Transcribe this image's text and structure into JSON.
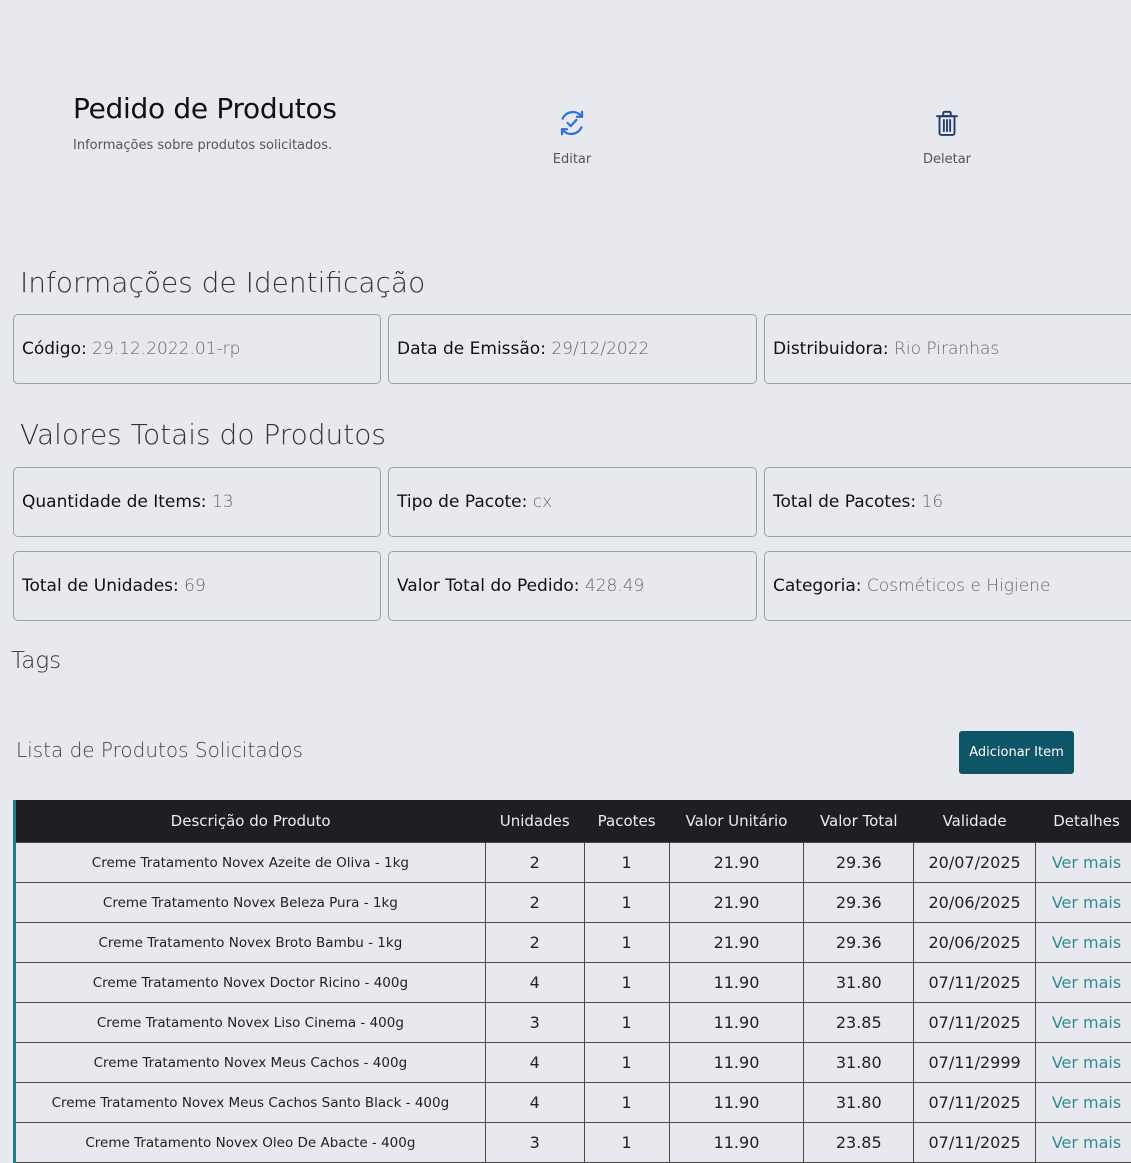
{
  "header": {
    "title": "Pedido de Produtos",
    "subtitle": "Informações sobre produtos solicitados.",
    "edit_label": "Editar",
    "delete_label": "Deletar"
  },
  "identification": {
    "title": "Informações de Identificação",
    "code_label": "Código:",
    "code_value": "29.12.2022.01-rp",
    "date_label": "Data de Emissão:",
    "date_value": "29/12/2022",
    "distributor_label": "Distribuidora:",
    "distributor_value": "Rio Piranhas"
  },
  "totals": {
    "title": "Valores Totais do Produtos",
    "items_label": "Quantidade de Items:",
    "items_value": "13",
    "package_type_label": "Tipo de Pacote:",
    "package_type_value": "cx",
    "total_packages_label": "Total de Pacotes:",
    "total_packages_value": "16",
    "total_units_label": "Total de Unidades:",
    "total_units_value": "69",
    "order_total_label": "Valor Total do Pedido:",
    "order_total_value": "428.49",
    "category_label": "Categoria:",
    "category_value": "Cosméticos e Higiene"
  },
  "tags": {
    "title": "Tags"
  },
  "product_list": {
    "title": "Lista de Produtos Solicitados",
    "add_button_label": "Adicionar Item",
    "columns": [
      "Descrição do Produto",
      "Unidades",
      "Pacotes",
      "Valor Unitário",
      "Valor Total",
      "Validade",
      "Detalhes"
    ],
    "rows": [
      {
        "description": "Creme Tratamento Novex Azeite de Oliva - 1kg",
        "units": "2",
        "packages": "1",
        "unit_price": "21.90",
        "total": "29.36",
        "expiry": "20/07/2025",
        "details": "Ver mais"
      },
      {
        "description": "Creme Tratamento Novex Beleza Pura - 1kg",
        "units": "2",
        "packages": "1",
        "unit_price": "21.90",
        "total": "29.36",
        "expiry": "20/06/2025",
        "details": "Ver mais"
      },
      {
        "description": "Creme Tratamento Novex Broto Bambu - 1kg",
        "units": "2",
        "packages": "1",
        "unit_price": "21.90",
        "total": "29.36",
        "expiry": "20/06/2025",
        "details": "Ver mais"
      },
      {
        "description": "Creme Tratamento Novex Doctor Ricino - 400g",
        "units": "4",
        "packages": "1",
        "unit_price": "11.90",
        "total": "31.80",
        "expiry": "07/11/2025",
        "details": "Ver mais"
      },
      {
        "description": "Creme Tratamento Novex Liso Cinema - 400g",
        "units": "3",
        "packages": "1",
        "unit_price": "11.90",
        "total": "23.85",
        "expiry": "07/11/2025",
        "details": "Ver mais"
      },
      {
        "description": "Creme Tratamento Novex Meus Cachos - 400g",
        "units": "4",
        "packages": "1",
        "unit_price": "11.90",
        "total": "31.80",
        "expiry": "07/11/2999",
        "details": "Ver mais"
      },
      {
        "description": "Creme Tratamento Novex Meus Cachos Santo Black - 400g",
        "units": "4",
        "packages": "1",
        "unit_price": "11.90",
        "total": "31.80",
        "expiry": "07/11/2025",
        "details": "Ver mais"
      },
      {
        "description": "Creme Tratamento Novex Oleo De Abacte - 400g",
        "units": "3",
        "packages": "1",
        "unit_price": "11.90",
        "total": "23.85",
        "expiry": "07/11/2025",
        "details": "Ver mais"
      }
    ]
  },
  "icons": {
    "edit": "refresh-icon",
    "delete": "trash-icon"
  },
  "colors": {
    "background": "#e8e9ee",
    "primary_button": "#0e5567",
    "table_header": "#1d1f22",
    "link": "#2f8b96",
    "icon": "#2f6fd8"
  }
}
